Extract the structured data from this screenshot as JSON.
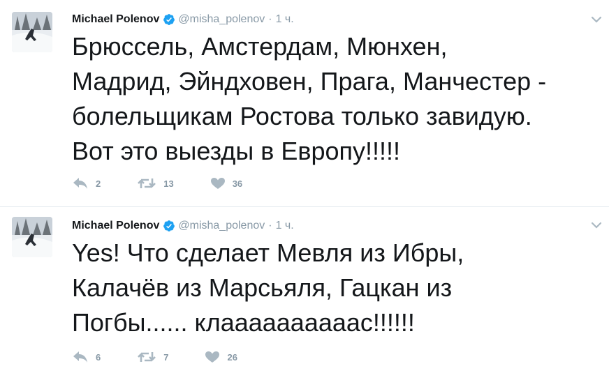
{
  "tweets": [
    {
      "author": "Michael Polenov",
      "handle": "@misha_polenov",
      "separator": "·",
      "time": "1 ч.",
      "lines": [
        "Брюссель, Амстердам, Мюнхен,",
        "Мадрид, Эйндховен, Прага, Манчестер -",
        "болельщикам Ростова только завидую.",
        "Вот это выезды в Европу!!!!!"
      ],
      "replies": "2",
      "retweets": "13",
      "likes": "36"
    },
    {
      "author": "Michael Polenov",
      "handle": "@misha_polenov",
      "separator": "·",
      "time": "1 ч.",
      "lines": [
        "Yes! Что сделает Мевля из Ибры,",
        "Калачёв из Марсьяля, Гацкан из",
        "Погбы...... клаааааааааас!!!!!!"
      ],
      "replies": "6",
      "retweets": "7",
      "likes": "26"
    }
  ],
  "colors": {
    "text": "#14171a",
    "muted": "#8899a6",
    "verified": "#1da1f2",
    "icon": "#aab8c2",
    "divider": "#e6ecf0"
  },
  "icons": [
    "verified-badge-icon",
    "chevron-down-icon",
    "reply-icon",
    "retweet-icon",
    "like-icon"
  ]
}
